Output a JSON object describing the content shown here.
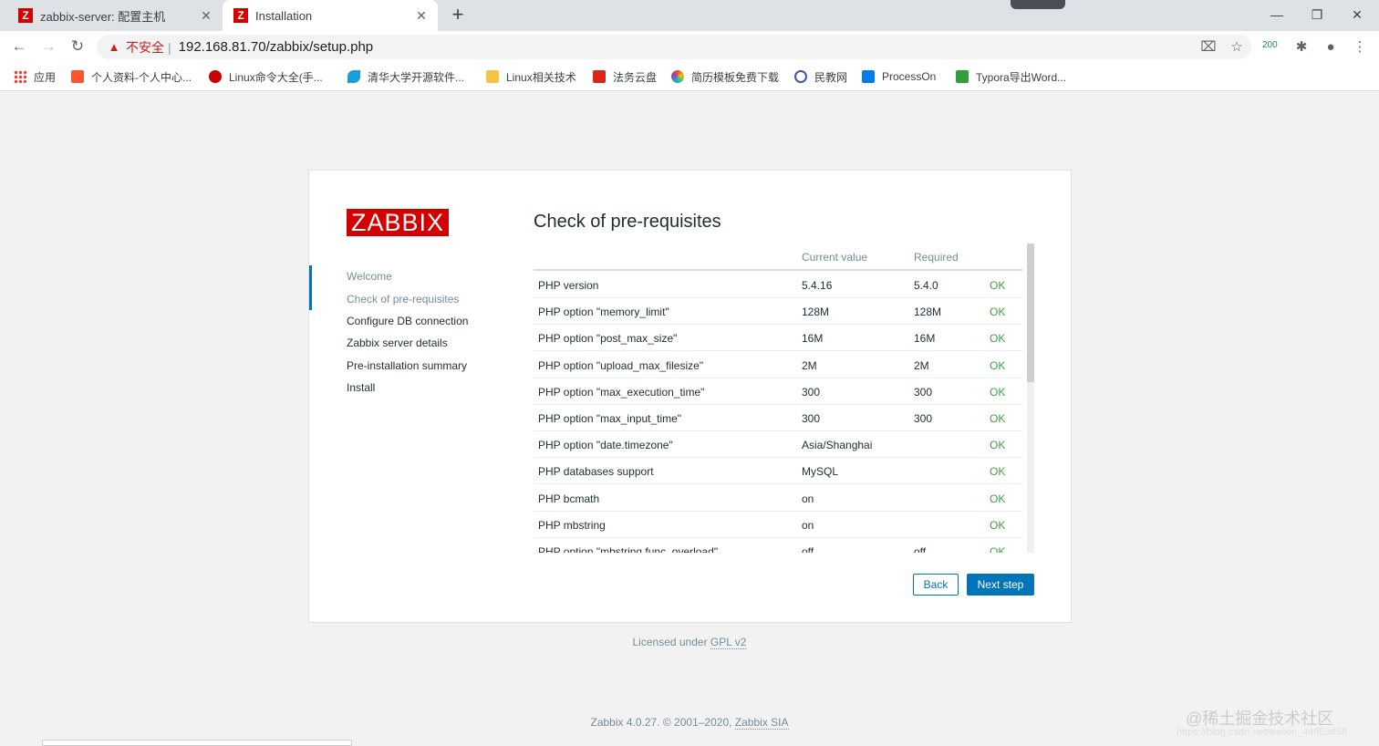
{
  "browser": {
    "tabs": [
      {
        "title": "zabbix-server: 配置主机",
        "favicon": "Z"
      },
      {
        "title": "Installation",
        "favicon": "Z"
      }
    ],
    "security_label": "不安全",
    "url": "192.168.81.70/zabbix/setup.php",
    "extension_badge": "200",
    "bookmarks": [
      {
        "label": "应用",
        "icon": "apps-grid-icon",
        "color": "#1a73e8"
      },
      {
        "label": "个人资料-个人中心...",
        "icon": "csdn-icon",
        "color": "#fc5531"
      },
      {
        "label": "Linux命令大全(手...",
        "icon": "redhat-icon",
        "color": "#cc0000"
      },
      {
        "label": "清华大学开源软件...",
        "icon": "tuna-icon",
        "color": "#1a9fdb"
      },
      {
        "label": "Linux相关技术",
        "icon": "folder-icon",
        "color": "#f6c342"
      },
      {
        "label": "法务云盘",
        "icon": "cloud-disk-icon",
        "color": "#d9261c"
      },
      {
        "label": "简历模板免费下载",
        "icon": "flower-icon",
        "color": "#8e44ad"
      },
      {
        "label": "民教网",
        "icon": "globe-icon",
        "color": "#3f51b5"
      },
      {
        "label": "ProcessOn",
        "icon": "processon-icon",
        "color": "#067bef"
      },
      {
        "label": "Typora导出Word...",
        "icon": "sf-icon",
        "color": "#2e9e3e"
      }
    ]
  },
  "setup": {
    "logo": "ZABBIX",
    "steps": [
      {
        "label": "Welcome",
        "state": "done"
      },
      {
        "label": "Check of pre-requisites",
        "state": "current"
      },
      {
        "label": "Configure DB connection",
        "state": "todo"
      },
      {
        "label": "Zabbix server details",
        "state": "todo"
      },
      {
        "label": "Pre-installation summary",
        "state": "todo"
      },
      {
        "label": "Install",
        "state": "todo"
      }
    ],
    "title": "Check of pre-requisites",
    "columns": [
      "",
      "Current value",
      "Required",
      ""
    ],
    "rows": [
      {
        "name": "PHP version",
        "current": "5.4.16",
        "required": "5.4.0",
        "status": "OK"
      },
      {
        "name": "PHP option \"memory_limit\"",
        "current": "128M",
        "required": "128M",
        "status": "OK"
      },
      {
        "name": "PHP option \"post_max_size\"",
        "current": "16M",
        "required": "16M",
        "status": "OK"
      },
      {
        "name": "PHP option \"upload_max_filesize\"",
        "current": "2M",
        "required": "2M",
        "status": "OK"
      },
      {
        "name": "PHP option \"max_execution_time\"",
        "current": "300",
        "required": "300",
        "status": "OK"
      },
      {
        "name": "PHP option \"max_input_time\"",
        "current": "300",
        "required": "300",
        "status": "OK"
      },
      {
        "name": "PHP option \"date.timezone\"",
        "current": "Asia/Shanghai",
        "required": "",
        "status": "OK"
      },
      {
        "name": "PHP databases support",
        "current": "MySQL",
        "required": "",
        "status": "OK"
      },
      {
        "name": "PHP bcmath",
        "current": "on",
        "required": "",
        "status": "OK"
      },
      {
        "name": "PHP mbstring",
        "current": "on",
        "required": "",
        "status": "OK"
      },
      {
        "name": "PHP option \"mbstring.func_overload\"",
        "current": "off",
        "required": "off",
        "status": "OK"
      }
    ],
    "back_label": "Back",
    "next_label": "Next step"
  },
  "license": {
    "prefix": "Licensed under ",
    "link": "GPL v2"
  },
  "footer": {
    "prefix": "Zabbix 4.0.27. © 2001–2020, ",
    "link": "Zabbix SIA"
  },
  "watermark": {
    "text": "@稀土掘金技术社区",
    "url": "https://blog.csdn.net/weixin_44953658"
  },
  "colors": {
    "brand": "#d40000",
    "accent": "#0275b8",
    "ok": "#429e47"
  }
}
